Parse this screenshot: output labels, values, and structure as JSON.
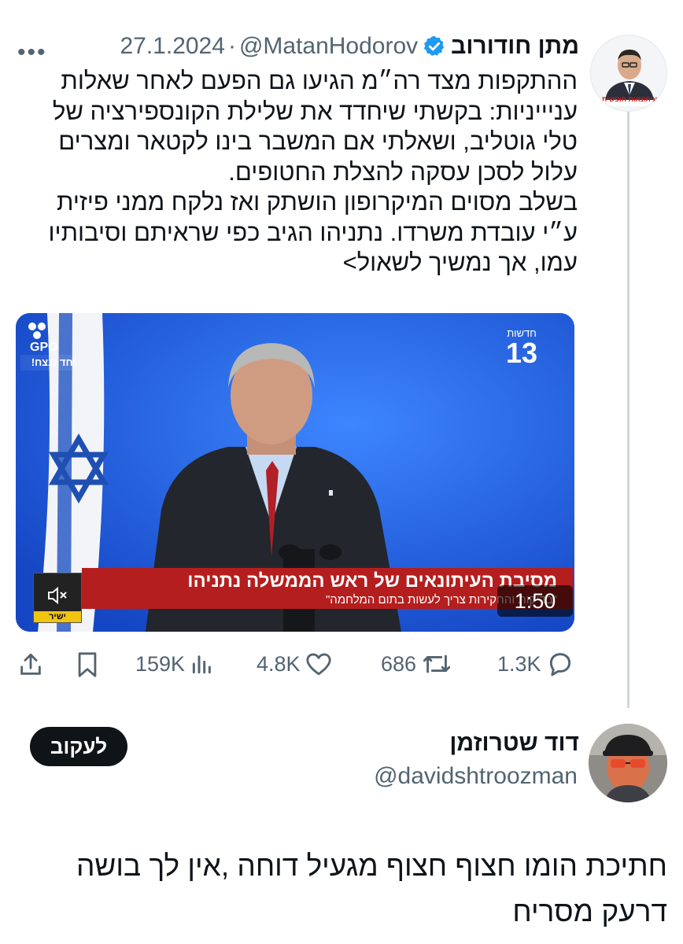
{
  "tweet": {
    "author_name": "מתן חודורוב",
    "handle": "@MatanHodorov",
    "separator": "·",
    "date": "27.1.2024",
    "avatar_caption": "עיתונאות חופשית",
    "body": [
      "ההתקפות מצד רה״מ הגיעו גם הפעם לאחר שאלות עניייניות: בקשתי שיחדד את שלילת הקונספירציה של טלי גוטליב, ושאלתי אם המשבר בינו לקטאר ומצרים עלול לסכן עסקה להצלת החטופים.",
      "בשלב מסוים המיקרופון הושתק ואז נלקח ממני פיזית ע״י עובדת משרדו. נתניהו הגיב כפי שראיתם וסיבותיו עמו, אך נמשיך לשאול>"
    ]
  },
  "media": {
    "channel_name": "חדשות",
    "channel_number": "13",
    "gpo_label": "GPO",
    "slogan": "יחד ננצח!",
    "live_label": "ישיר",
    "banner_title": "מסיבת העיתונאים של ראש הממשלה נתניהו",
    "banner_subtitle": "\"בדיקות והחקירות צריך לעשות בתום המלחמה\"",
    "duration": "1:50",
    "colors": {
      "background": "#1e63e6",
      "banner": "#b51e1e",
      "flag_blue": "#1f4fb3"
    }
  },
  "actions": {
    "views": "159K",
    "likes": "4.8K",
    "reposts": "686",
    "replies": "1.3K"
  },
  "reply_author": {
    "name": "דוד שטרוזמן",
    "handle": "@davidshtroozman",
    "follow_label": "לעקוב"
  },
  "reply_text": "חתיכת הומו חצוף חצוף מגעיל דוחה ,אין לך בושה דרעק מסריח"
}
